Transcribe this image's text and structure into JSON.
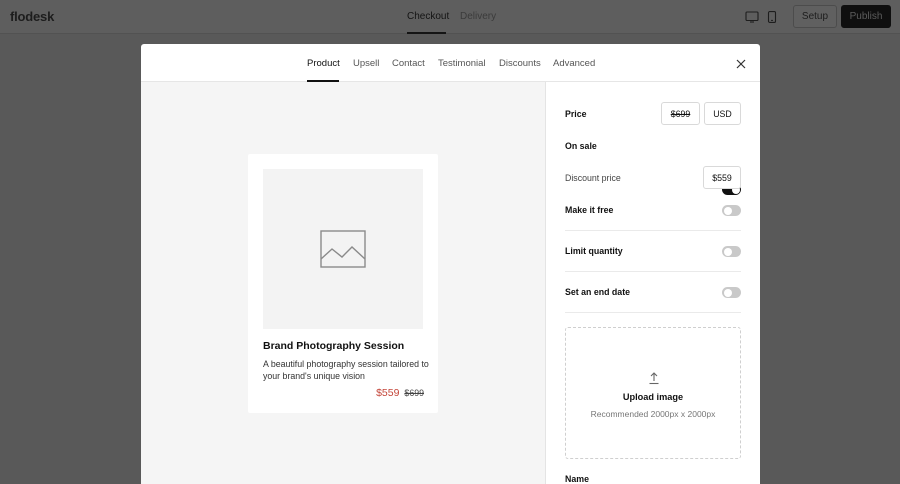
{
  "app": {
    "logo": "flodesk"
  },
  "topbar": {
    "tabs": [
      {
        "label": "Checkout",
        "active": true
      },
      {
        "label": "Delivery",
        "active": false
      }
    ],
    "devices": [
      "desktop-icon",
      "mobile-icon"
    ],
    "setup_label": "Setup",
    "publish_label": "Publish"
  },
  "modal": {
    "tabs": [
      {
        "label": "Product",
        "active": true
      },
      {
        "label": "Upsell"
      },
      {
        "label": "Contact"
      },
      {
        "label": "Testimonial"
      },
      {
        "label": "Discounts"
      },
      {
        "label": "Advanced"
      }
    ],
    "close_icon": "close-icon"
  },
  "preview": {
    "image_icon": "image-placeholder-icon",
    "title": "Brand Photography Session",
    "description": "A beautiful photography session tailored to your brand's unique vision",
    "sale_price": "$559",
    "original_price": "$699"
  },
  "settings": {
    "price": {
      "label": "Price",
      "value": "$699",
      "currency": "USD"
    },
    "on_sale": {
      "label": "On sale",
      "value": true
    },
    "discount_price": {
      "label": "Discount price",
      "value": "$559"
    },
    "make_free": {
      "label": "Make it free",
      "value": false
    },
    "limit_quantity": {
      "label": "Limit quantity",
      "value": false
    },
    "end_date": {
      "label": "Set an end date",
      "value": false
    },
    "upload": {
      "icon": "upload-icon",
      "title": "Upload image",
      "subtitle": "Recommended 2000px x 2000px"
    },
    "name_label": "Name"
  },
  "colors": {
    "sale": "#c4463a",
    "toggle_on": "#111111",
    "toggle_off": "#c9c9c9",
    "overlay": "#595959"
  }
}
